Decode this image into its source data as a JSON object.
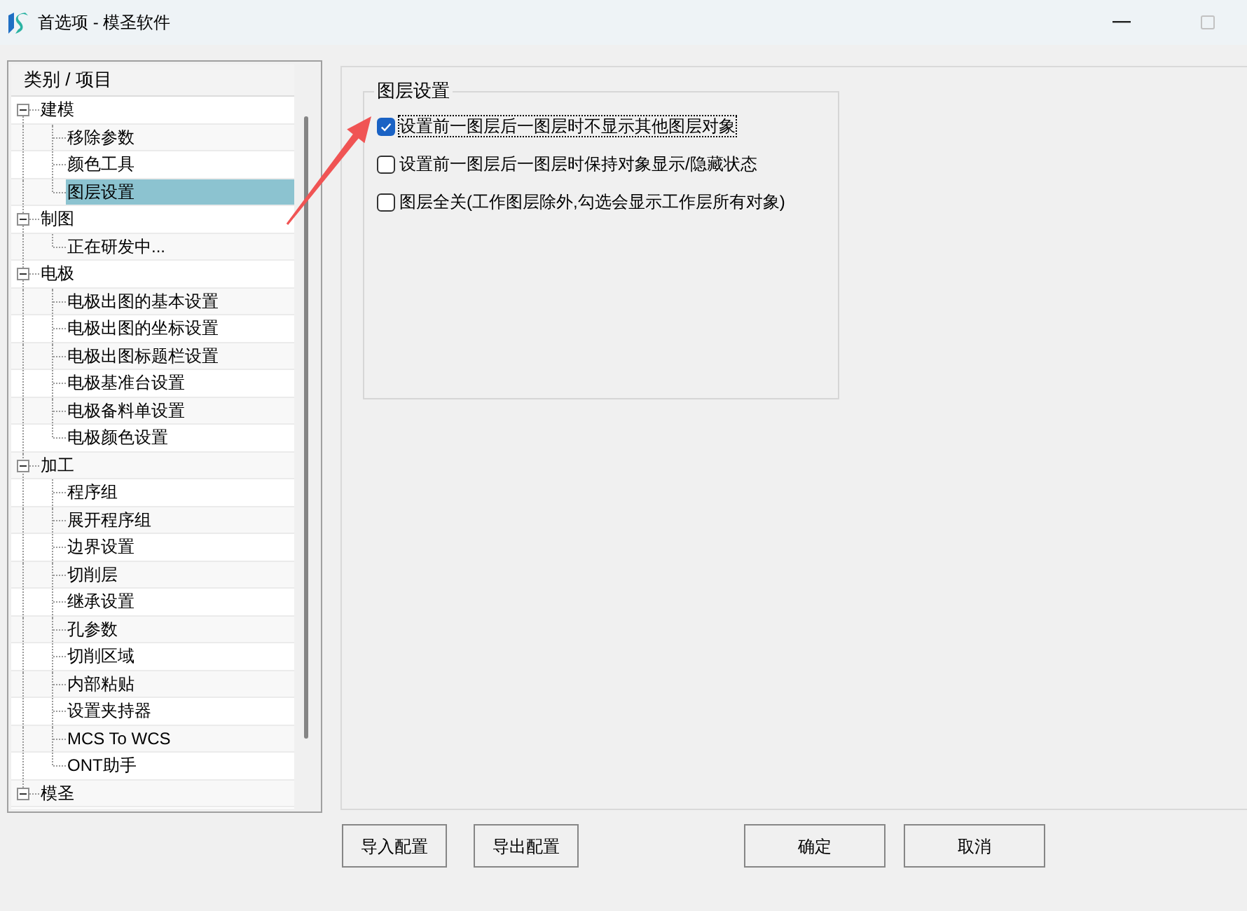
{
  "window": {
    "title": "首选项 - 模圣软件"
  },
  "tree": {
    "header": "类别 / 项目",
    "items": [
      {
        "label": "建模",
        "expanded": true,
        "selected": false,
        "children": [
          {
            "label": "移除参数",
            "selected": false
          },
          {
            "label": "颜色工具",
            "selected": false
          },
          {
            "label": "图层设置",
            "selected": true
          }
        ]
      },
      {
        "label": "制图",
        "expanded": true,
        "selected": false,
        "children": [
          {
            "label": "正在研发中...",
            "selected": false
          }
        ]
      },
      {
        "label": "电极",
        "expanded": true,
        "selected": false,
        "children": [
          {
            "label": "电极出图的基本设置",
            "selected": false
          },
          {
            "label": "电极出图的坐标设置",
            "selected": false
          },
          {
            "label": "电极出图标题栏设置",
            "selected": false
          },
          {
            "label": "电极基准台设置",
            "selected": false
          },
          {
            "label": "电极备料单设置",
            "selected": false
          },
          {
            "label": "电极颜色设置",
            "selected": false
          }
        ]
      },
      {
        "label": "加工",
        "expanded": true,
        "selected": false,
        "children": [
          {
            "label": "程序组",
            "selected": false
          },
          {
            "label": "展开程序组",
            "selected": false
          },
          {
            "label": "边界设置",
            "selected": false
          },
          {
            "label": "切削层",
            "selected": false
          },
          {
            "label": "继承设置",
            "selected": false
          },
          {
            "label": "孔参数",
            "selected": false
          },
          {
            "label": "切削区域",
            "selected": false
          },
          {
            "label": "内部粘贴",
            "selected": false
          },
          {
            "label": "设置夹持器",
            "selected": false
          },
          {
            "label": "MCS To WCS",
            "selected": false
          },
          {
            "label": "ONT助手",
            "selected": false
          }
        ]
      },
      {
        "label": "模圣",
        "expanded": true,
        "selected": false
      }
    ]
  },
  "layer_settings": {
    "title": "图层设置",
    "options": [
      {
        "label": "设置前一图层后一图层时不显示其他图层对象",
        "checked": true,
        "focused": true
      },
      {
        "label": "设置前一图层后一图层时保持对象显示/隐藏状态",
        "checked": false,
        "focused": false
      },
      {
        "label": "图层全关(工作图层除外,勾选会显示工作层所有对象)",
        "checked": false,
        "focused": false
      }
    ]
  },
  "footer": {
    "config_buttons": [
      "导入配置",
      "导出配置"
    ],
    "dialog_buttons": [
      "确定",
      "取消"
    ]
  }
}
